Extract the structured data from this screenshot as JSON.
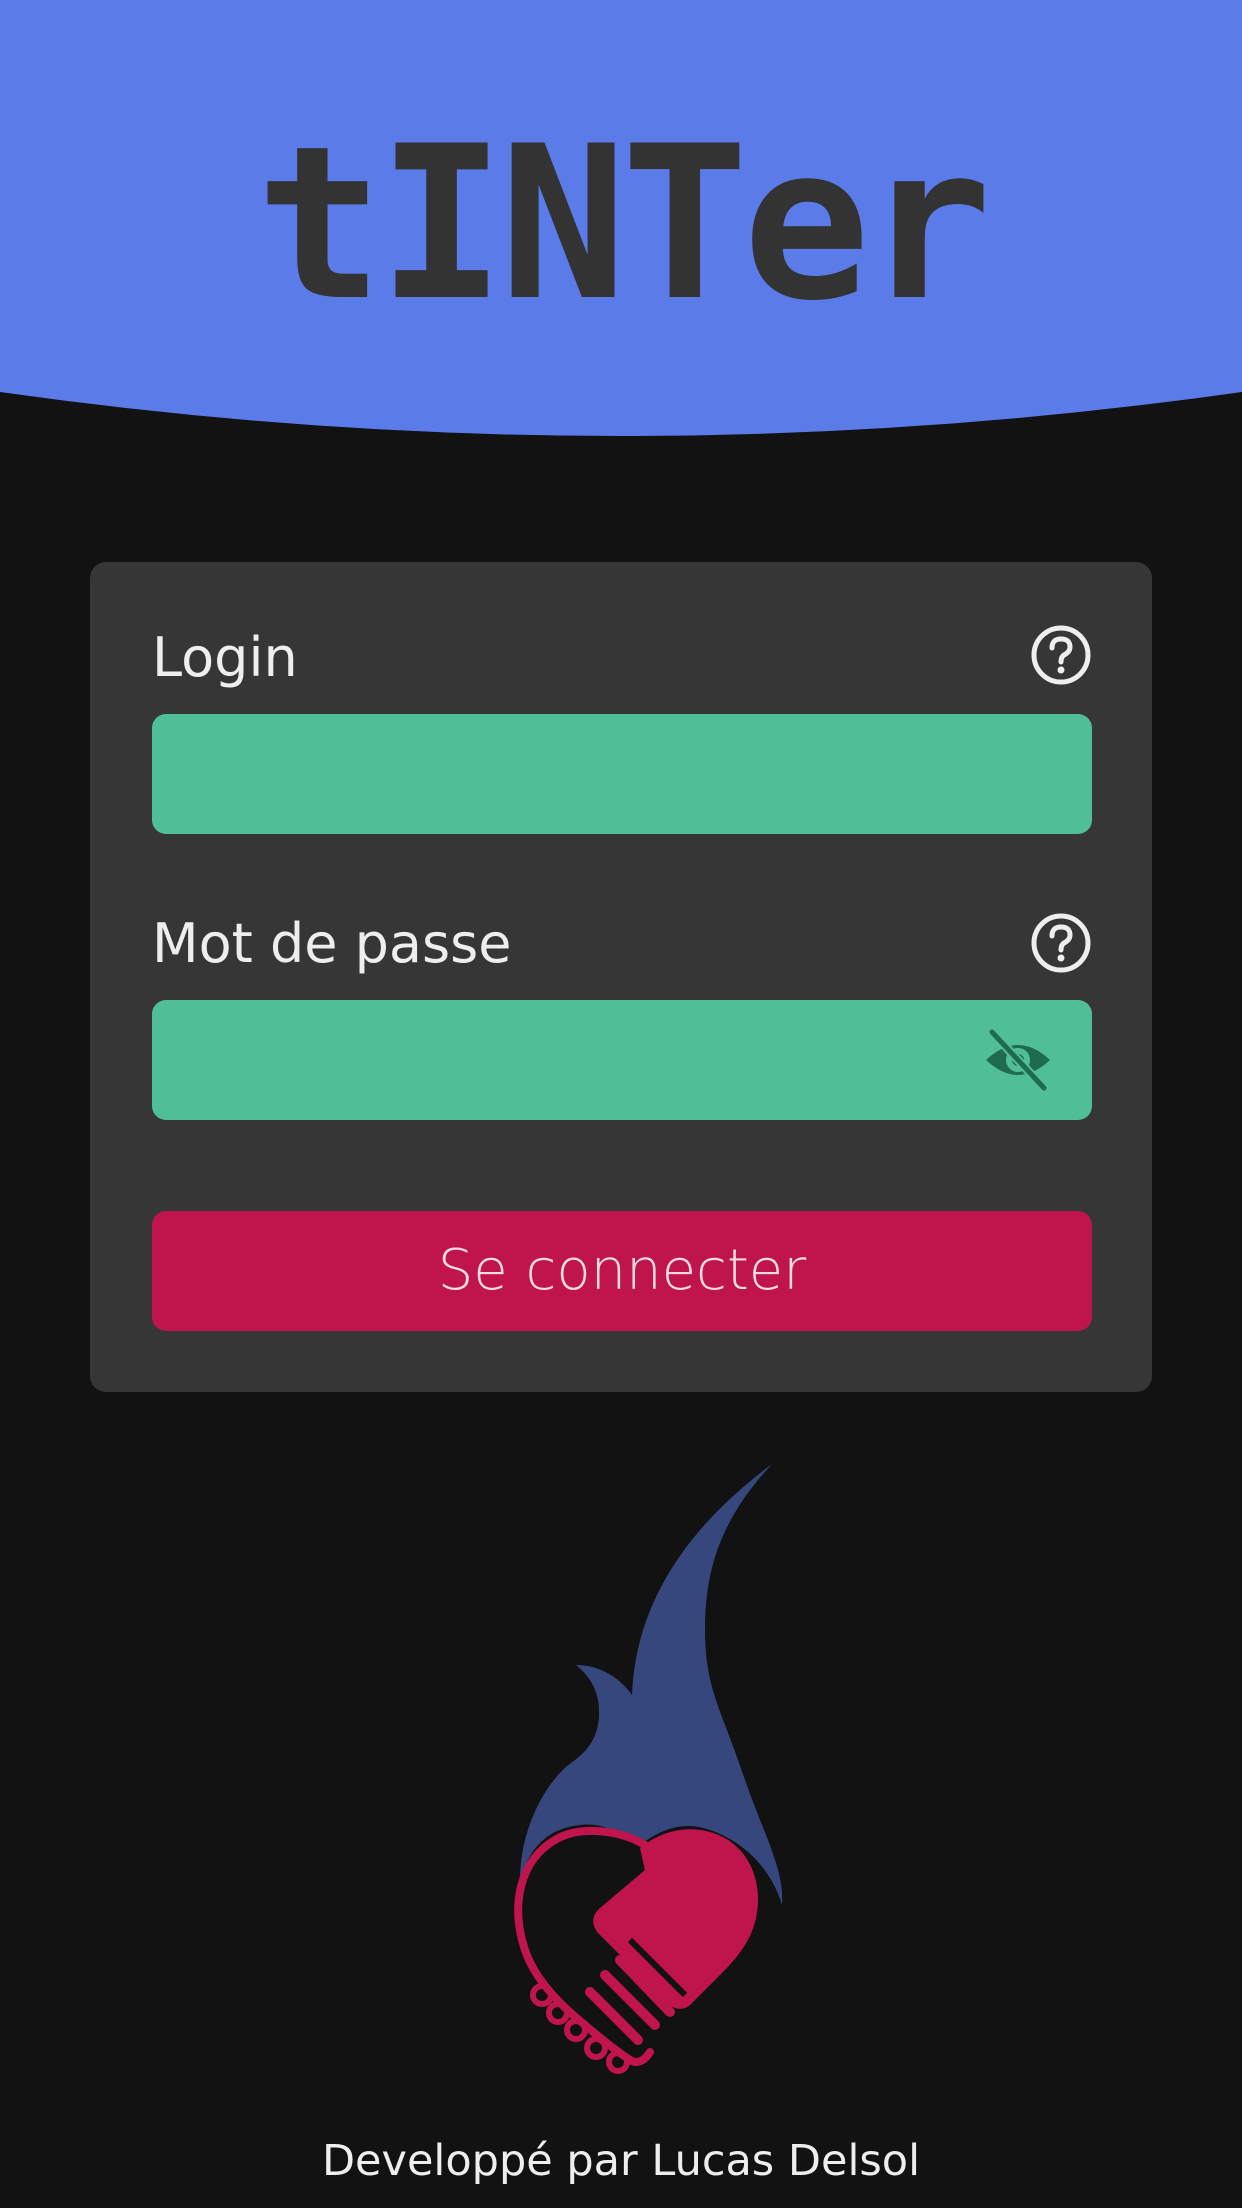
{
  "app": {
    "title": "tINTer"
  },
  "login_form": {
    "login_label": "Login",
    "login_value": "",
    "password_label": "Mot de passe",
    "password_value": "",
    "submit_label": "Se connecter"
  },
  "icons": {
    "login_help": "help-circle-icon",
    "password_help": "help-circle-icon",
    "password_visibility": "eye-off-icon",
    "logo": "flame-heart-handshake-logo"
  },
  "footer": {
    "credit": "Developpé par Lucas Delsol"
  },
  "colors": {
    "header": "#5b7be9",
    "background": "#121212",
    "card": "#363636",
    "input": "#50bf98",
    "button": "#c0154c",
    "flame": "#36477e"
  }
}
